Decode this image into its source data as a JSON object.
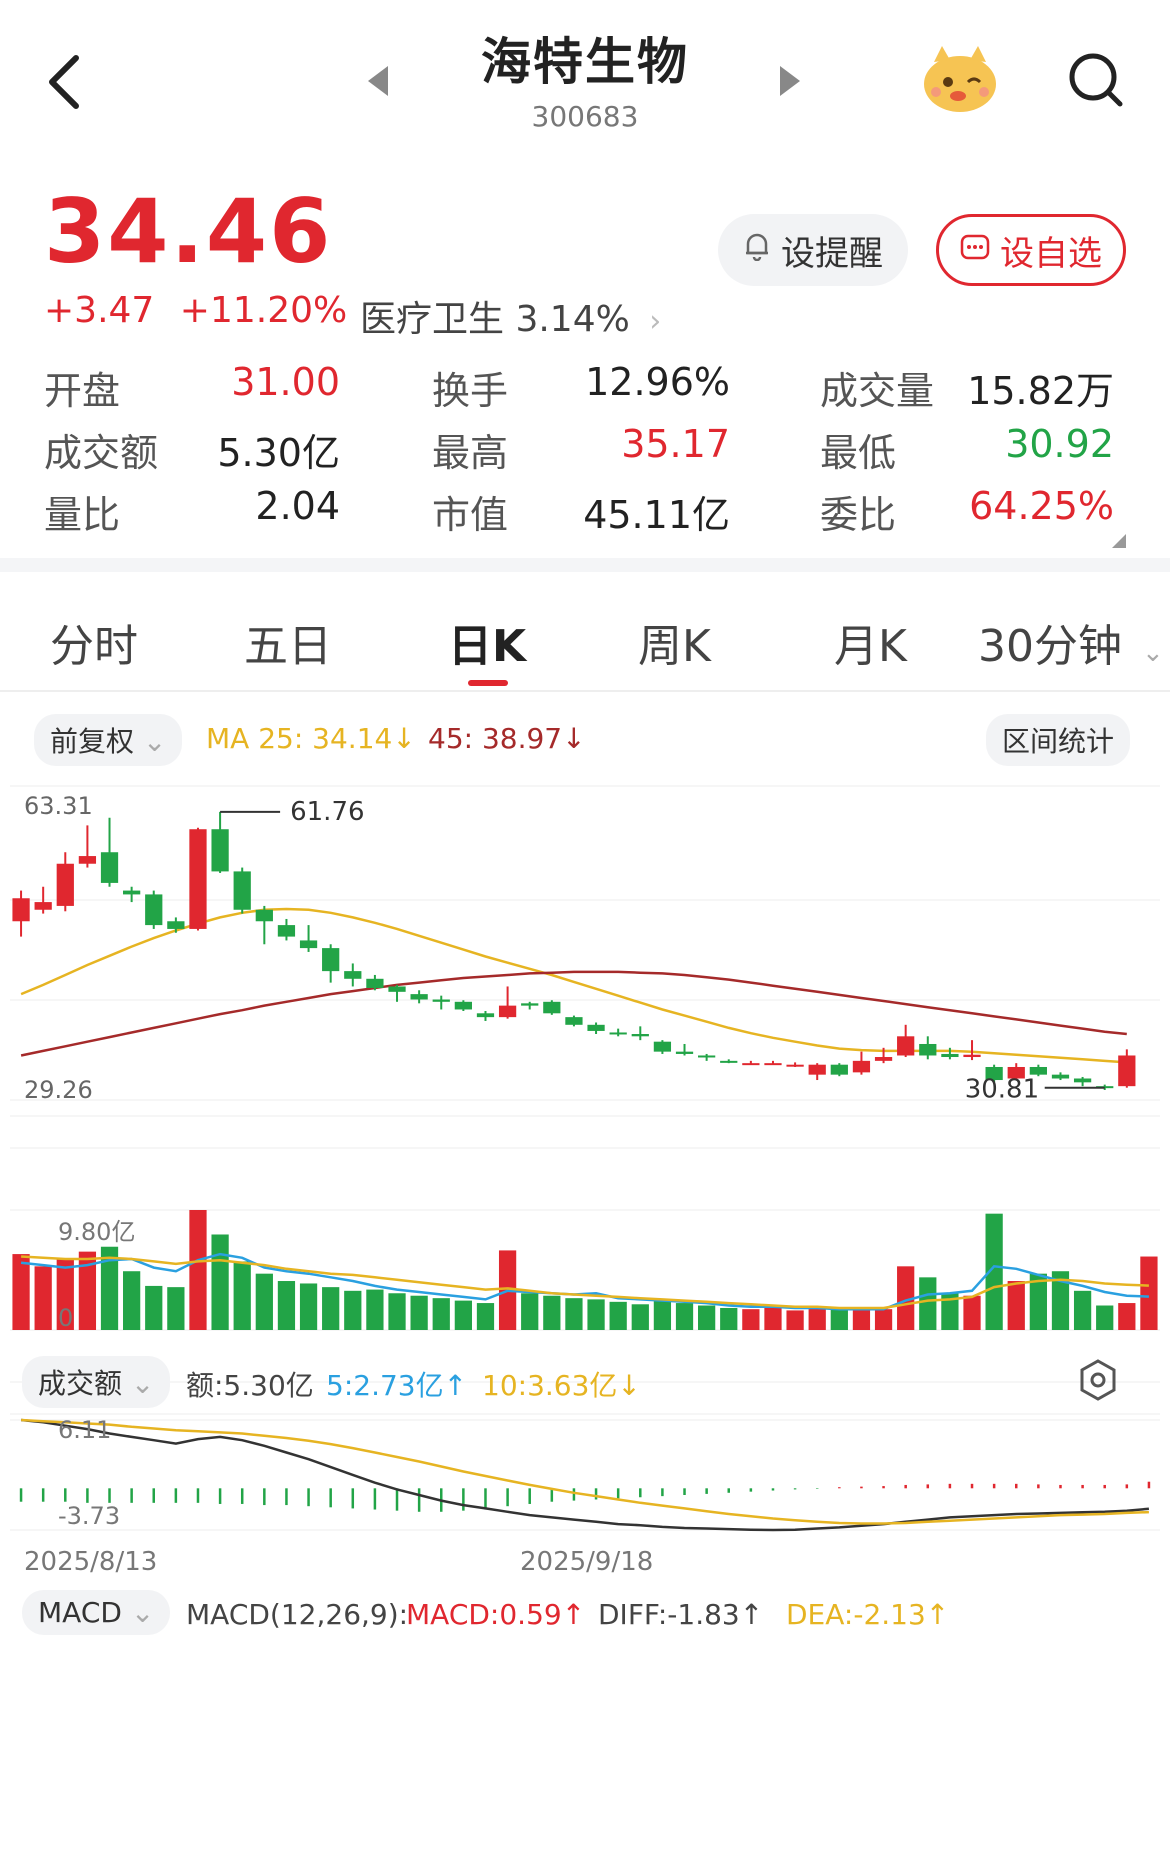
{
  "header": {
    "title": "海特生物",
    "code": "300683"
  },
  "quote": {
    "price": "34.46",
    "change": "+3.47",
    "change_pct": "+11.20%",
    "sector": "医疗卫生 3.14%",
    "remind_label": "设提醒",
    "fav_label": "设自选"
  },
  "stats": [
    {
      "label": "开盘",
      "value": "31.00",
      "color": "red"
    },
    {
      "label": "换手",
      "value": "12.96%",
      "color": "black"
    },
    {
      "label": "成交量",
      "value": "15.82万",
      "color": "black"
    },
    {
      "label": "成交额",
      "value": "5.30亿",
      "color": "black"
    },
    {
      "label": "最高",
      "value": "35.17",
      "color": "red"
    },
    {
      "label": "最低",
      "value": "30.92",
      "color": "green"
    },
    {
      "label": "量比",
      "value": "2.04",
      "color": "black"
    },
    {
      "label": "市值",
      "value": "45.11亿",
      "color": "black"
    },
    {
      "label": "委比",
      "value": "64.25%",
      "color": "red"
    }
  ],
  "tabs": [
    "分时",
    "五日",
    "日K",
    "周K",
    "月K",
    "30分钟"
  ],
  "active_tab": "日K",
  "kline": {
    "adjust_label": "前复权",
    "ma25": "MA 25: 34.14↓",
    "ma45": "45: 38.97↓",
    "interval_stats": "区间统计",
    "y_max_label": "63.31",
    "y_min_label": "29.26",
    "high_mark": "61.76",
    "low_mark": "30.81"
  },
  "volume": {
    "label": "成交额",
    "amount": "额:5.30亿",
    "ma5": "5:2.73亿↑",
    "ma10": "10:3.63亿↓",
    "y_max_label": "9.80亿",
    "y_min_label": "0"
  },
  "macd": {
    "label": "MACD",
    "params": "MACD(12,26,9):",
    "macd": "MACD:0.59↑",
    "diff": "DIFF:-1.83↑",
    "dea": "DEA:-2.13↑",
    "y_max_label": "6.11",
    "y_min_label": "-3.73"
  },
  "x_labels": [
    "2025/8/13",
    "2025/9/18"
  ],
  "colors": {
    "up": "#e0272f",
    "down": "#22a447",
    "ma25": "#e6b422",
    "ma45": "#a52a2a",
    "vol_ma5": "#2aa0e0"
  },
  "chart_data": {
    "type": "candlestick",
    "ylim": [
      29.26,
      63.31
    ],
    "candles": [
      {
        "o": 47.5,
        "c": 50.5,
        "h": 51.5,
        "l": 45.5
      },
      {
        "o": 49.0,
        "c": 50.0,
        "h": 52.0,
        "l": 48.5
      },
      {
        "o": 49.5,
        "c": 55.0,
        "h": 56.5,
        "l": 48.8
      },
      {
        "o": 55.0,
        "c": 56.0,
        "h": 60.0,
        "l": 54.5
      },
      {
        "o": 56.5,
        "c": 52.5,
        "h": 61.0,
        "l": 52.0
      },
      {
        "o": 51.5,
        "c": 51.0,
        "h": 52.0,
        "l": 50.0
      },
      {
        "o": 51.0,
        "c": 47.0,
        "h": 51.5,
        "l": 46.5
      },
      {
        "o": 47.5,
        "c": 46.5,
        "h": 48.0,
        "l": 46.0
      },
      {
        "o": 46.5,
        "c": 59.5,
        "h": 59.7,
        "l": 46.3
      },
      {
        "o": 59.5,
        "c": 54.0,
        "h": 61.76,
        "l": 53.8
      },
      {
        "o": 54.0,
        "c": 49.0,
        "h": 54.5,
        "l": 48.5
      },
      {
        "o": 49.0,
        "c": 47.5,
        "h": 49.5,
        "l": 44.5
      },
      {
        "o": 47.0,
        "c": 45.5,
        "h": 47.8,
        "l": 45.0
      },
      {
        "o": 45.0,
        "c": 44.0,
        "h": 47.0,
        "l": 43.5
      },
      {
        "o": 44.0,
        "c": 41.0,
        "h": 44.5,
        "l": 39.5
      },
      {
        "o": 41.0,
        "c": 40.0,
        "h": 42.0,
        "l": 39.0
      },
      {
        "o": 40.0,
        "c": 38.8,
        "h": 40.5,
        "l": 38.5
      },
      {
        "o": 39.0,
        "c": 38.3,
        "h": 39.2,
        "l": 37.0
      },
      {
        "o": 38.0,
        "c": 37.3,
        "h": 38.5,
        "l": 36.8
      },
      {
        "o": 37.3,
        "c": 37.0,
        "h": 37.8,
        "l": 36.0
      },
      {
        "o": 37.0,
        "c": 36.0,
        "h": 37.2,
        "l": 35.8
      },
      {
        "o": 35.5,
        "c": 35.0,
        "h": 35.8,
        "l": 34.5
      },
      {
        "o": 35.0,
        "c": 36.5,
        "h": 39.0,
        "l": 34.8
      },
      {
        "o": 36.8,
        "c": 36.5,
        "h": 37.0,
        "l": 36.0
      },
      {
        "o": 37.0,
        "c": 35.5,
        "h": 37.2,
        "l": 35.3
      },
      {
        "o": 35.0,
        "c": 34.0,
        "h": 35.2,
        "l": 33.8
      },
      {
        "o": 34.0,
        "c": 33.2,
        "h": 34.3,
        "l": 32.8
      },
      {
        "o": 33.0,
        "c": 32.8,
        "h": 33.5,
        "l": 32.5
      },
      {
        "o": 32.8,
        "c": 32.5,
        "h": 33.8,
        "l": 32.0
      },
      {
        "o": 31.8,
        "c": 30.5,
        "h": 32.0,
        "l": 30.2
      },
      {
        "o": 30.5,
        "c": 30.2,
        "h": 31.5,
        "l": 30.0
      },
      {
        "o": 30.0,
        "c": 29.8,
        "h": 30.2,
        "l": 29.3
      },
      {
        "o": 29.3,
        "c": 29.2,
        "h": 29.5,
        "l": 29.0
      },
      {
        "o": 29.0,
        "c": 29.0,
        "h": 29.3,
        "l": 28.8
      },
      {
        "o": 29.0,
        "c": 29.0,
        "h": 29.3,
        "l": 28.8
      },
      {
        "o": 28.8,
        "c": 28.8,
        "h": 29.1,
        "l": 28.5
      },
      {
        "o": 27.5,
        "c": 28.8,
        "h": 29.0,
        "l": 26.8
      },
      {
        "o": 28.8,
        "c": 27.5,
        "h": 29.0,
        "l": 27.3
      },
      {
        "o": 27.8,
        "c": 29.3,
        "h": 30.5,
        "l": 27.5
      },
      {
        "o": 29.3,
        "c": 29.8,
        "h": 31.0,
        "l": 29.0
      },
      {
        "o": 30.0,
        "c": 32.5,
        "h": 34.0,
        "l": 29.8
      },
      {
        "o": 31.5,
        "c": 30.0,
        "h": 32.5,
        "l": 29.5
      },
      {
        "o": 30.2,
        "c": 29.8,
        "h": 31.0,
        "l": 29.5
      },
      {
        "o": 29.8,
        "c": 30.1,
        "h": 32.0,
        "l": 29.4
      },
      {
        "o": 28.5,
        "c": 26.8,
        "h": 28.8,
        "l": 26.5
      },
      {
        "o": 27.0,
        "c": 28.5,
        "h": 29.0,
        "l": 26.8
      },
      {
        "o": 28.5,
        "c": 27.5,
        "h": 28.8,
        "l": 27.3
      },
      {
        "o": 27.5,
        "c": 27.0,
        "h": 27.8,
        "l": 26.8
      },
      {
        "o": 27.0,
        "c": 26.5,
        "h": 27.2,
        "l": 26.0
      },
      {
        "o": 26.0,
        "c": 25.8,
        "h": 26.2,
        "l": 25.5
      },
      {
        "o": 26.0,
        "c": 30.0,
        "h": 30.8,
        "l": 25.8
      }
    ],
    "ma25": [
      38.0,
      39.2,
      40.5,
      41.8,
      43.0,
      44.2,
      45.3,
      46.3,
      47.2,
      48.0,
      48.6,
      49.0,
      49.1,
      49.0,
      48.6,
      48.0,
      47.3,
      46.5,
      45.6,
      44.7,
      43.8,
      42.9,
      42.1,
      41.3,
      40.5,
      39.6,
      38.7,
      37.8,
      36.9,
      36.0,
      35.2,
      34.4,
      33.6,
      32.9,
      32.3,
      31.8,
      31.3,
      30.9,
      30.7,
      30.6,
      30.6,
      30.6,
      30.6,
      30.5,
      30.3,
      30.1,
      29.9,
      29.7,
      29.5,
      29.3,
      29.1
    ],
    "ma45": [
      30.0,
      30.6,
      31.2,
      31.8,
      32.4,
      33.0,
      33.6,
      34.2,
      34.8,
      35.4,
      35.9,
      36.5,
      37.0,
      37.5,
      38.0,
      38.4,
      38.8,
      39.2,
      39.5,
      39.8,
      40.1,
      40.3,
      40.5,
      40.7,
      40.8,
      40.9,
      40.9,
      40.9,
      40.8,
      40.7,
      40.5,
      40.2,
      39.9,
      39.5,
      39.1,
      38.7,
      38.3,
      37.9,
      37.5,
      37.1,
      36.7,
      36.3,
      35.9,
      35.5,
      35.1,
      34.7,
      34.3,
      33.9,
      33.5,
      33.1,
      32.8
    ],
    "volume": [
      6.2,
      5.2,
      5.8,
      6.4,
      6.8,
      4.8,
      3.6,
      3.5,
      9.8,
      7.8,
      5.6,
      4.6,
      4.0,
      3.8,
      3.5,
      3.2,
      3.3,
      3.0,
      2.8,
      2.6,
      2.4,
      2.2,
      6.5,
      3.0,
      2.8,
      2.6,
      2.5,
      2.3,
      2.1,
      2.4,
      2.2,
      2.0,
      1.8,
      1.7,
      1.8,
      1.6,
      1.8,
      1.7,
      1.6,
      1.7,
      5.2,
      4.3,
      3.0,
      2.8,
      9.5,
      4.0,
      4.6,
      4.8,
      3.2,
      2.0,
      2.2,
      6.0
    ],
    "vol_ma5": [
      5.5,
      5.3,
      5.1,
      5.3,
      5.7,
      5.8,
      5.1,
      4.8,
      5.7,
      6.2,
      5.9,
      5.1,
      4.8,
      4.6,
      4.3,
      4.0,
      3.6,
      3.3,
      3.1,
      2.9,
      2.7,
      2.5,
      3.2,
      3.1,
      3.0,
      2.9,
      3.0,
      2.6,
      2.5,
      2.4,
      2.3,
      2.2,
      2.0,
      1.9,
      1.9,
      1.8,
      1.8,
      1.7,
      1.7,
      1.7,
      2.4,
      2.9,
      3.0,
      3.2,
      5.2,
      5.0,
      4.5,
      4.0,
      3.6,
      3.1,
      2.8,
      2.73
    ],
    "vol_ma10": [
      6.0,
      5.9,
      5.8,
      5.8,
      5.9,
      5.8,
      5.6,
      5.4,
      5.6,
      5.7,
      5.5,
      5.3,
      5.0,
      4.8,
      4.6,
      4.5,
      4.3,
      4.1,
      3.9,
      3.7,
      3.5,
      3.3,
      3.4,
      3.2,
      3.0,
      2.9,
      2.8,
      2.7,
      2.6,
      2.5,
      2.4,
      2.3,
      2.2,
      2.1,
      2.0,
      1.9,
      1.9,
      1.8,
      1.8,
      1.8,
      2.1,
      2.4,
      2.5,
      2.7,
      3.5,
      3.8,
      4.0,
      4.1,
      4.0,
      3.8,
      3.7,
      3.63
    ],
    "macd_hist": [
      -1.2,
      -1.2,
      -1.2,
      -1.3,
      -1.3,
      -1.3,
      -1.3,
      -1.3,
      -1.3,
      -1.4,
      -1.4,
      -1.5,
      -1.5,
      -1.6,
      -1.7,
      -1.8,
      -1.9,
      -2.0,
      -2.1,
      -2.1,
      -2.0,
      -1.9,
      -1.6,
      -1.4,
      -1.2,
      -1.1,
      -1.0,
      -0.9,
      -0.8,
      -0.7,
      -0.6,
      -0.5,
      -0.4,
      -0.3,
      -0.2,
      -0.1,
      -0.05,
      0.1,
      0.15,
      0.2,
      0.3,
      0.35,
      0.4,
      0.4,
      0.4,
      0.4,
      0.35,
      0.3,
      0.3,
      0.3,
      0.35,
      0.59
    ],
    "diff": [
      6.11,
      5.9,
      5.6,
      5.3,
      4.9,
      4.6,
      4.3,
      4.0,
      4.4,
      4.6,
      4.3,
      3.8,
      3.2,
      2.6,
      1.9,
      1.2,
      0.5,
      -0.1,
      -0.6,
      -1.1,
      -1.5,
      -1.8,
      -2.1,
      -2.4,
      -2.6,
      -2.8,
      -3.0,
      -3.2,
      -3.3,
      -3.45,
      -3.55,
      -3.6,
      -3.65,
      -3.7,
      -3.73,
      -3.7,
      -3.6,
      -3.5,
      -3.35,
      -3.2,
      -3.0,
      -2.8,
      -2.6,
      -2.5,
      -2.4,
      -2.3,
      -2.25,
      -2.2,
      -2.15,
      -2.1,
      -2.0,
      -1.83
    ],
    "dea": [
      6.11,
      6.0,
      5.9,
      5.8,
      5.7,
      5.5,
      5.35,
      5.2,
      5.1,
      5.0,
      4.9,
      4.7,
      4.5,
      4.25,
      3.95,
      3.6,
      3.2,
      2.8,
      2.4,
      1.95,
      1.5,
      1.1,
      0.7,
      0.3,
      -0.05,
      -0.4,
      -0.7,
      -1.0,
      -1.3,
      -1.55,
      -1.8,
      -2.05,
      -2.3,
      -2.5,
      -2.7,
      -2.85,
      -3.0,
      -3.1,
      -3.15,
      -3.15,
      -3.1,
      -3.0,
      -2.9,
      -2.8,
      -2.7,
      -2.6,
      -2.5,
      -2.4,
      -2.35,
      -2.3,
      -2.2,
      -2.13
    ],
    "macd_ylim": [
      -3.73,
      6.11
    ]
  }
}
